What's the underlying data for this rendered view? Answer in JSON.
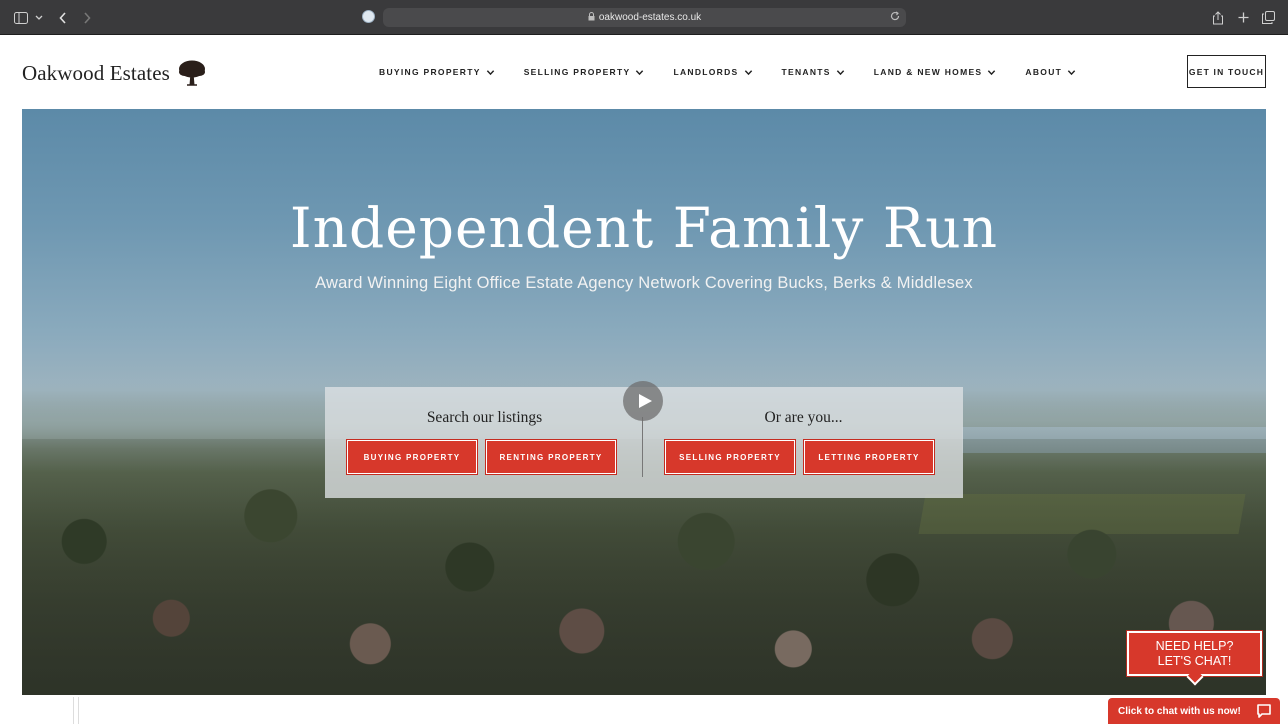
{
  "browser": {
    "url": "oakwood-estates.co.uk",
    "icons": [
      "sidebar-icon",
      "chevron-down-icon",
      "back-icon",
      "forward-icon",
      "lock-icon",
      "reload-icon",
      "share-icon",
      "new-tab-icon",
      "tabs-icon"
    ]
  },
  "header": {
    "logo_text": "Oakwood Estates",
    "nav": [
      {
        "label": "BUYING PROPERTY"
      },
      {
        "label": "SELLING PROPERTY"
      },
      {
        "label": "LANDLORDS"
      },
      {
        "label": "TENANTS"
      },
      {
        "label": "LAND & NEW HOMES"
      },
      {
        "label": "ABOUT"
      }
    ],
    "cta_label": "GET IN TOUCH"
  },
  "hero": {
    "title": "Independent Family Run",
    "subtitle": "Award Winning Eight Office Estate Agency Network Covering Bucks, Berks & Middlesex",
    "search_heading": "Search our listings",
    "alt_heading": "Or are you...",
    "buttons": [
      {
        "label": "BUYING PROPERTY"
      },
      {
        "label": "RENTING PROPERTY"
      },
      {
        "label": "SELLING PROPERTY"
      },
      {
        "label": "LETTING PROPERTY"
      }
    ]
  },
  "chat": {
    "bubble_line1": "NEED HELP?",
    "bubble_line2": "LET'S CHAT!",
    "bar_label": "Click to chat with us now!"
  },
  "colors": {
    "accent_red": "#d7382b",
    "text_dark": "#222222",
    "chrome_bg": "#3a3a3c"
  }
}
